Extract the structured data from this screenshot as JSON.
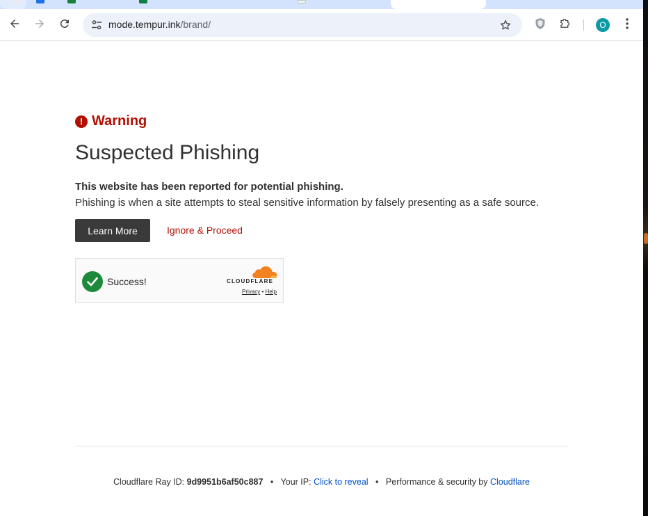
{
  "browser": {
    "url_host": "mode.tempur.ink",
    "url_path": "/brand/",
    "profile_initial": "O",
    "icons": {
      "back": "arrow-left-icon",
      "forward": "arrow-right-icon",
      "reload": "reload-icon",
      "site_info": "tune-icon",
      "bookmark": "star-icon",
      "shield": "shield-extension-icon",
      "extensions": "puzzle-icon",
      "menu": "kebab-menu-icon"
    }
  },
  "page": {
    "warning_label": "Warning",
    "title": "Suspected Phishing",
    "lead": "This website has been reported for potential phishing.",
    "description": "Phishing is when a site attempts to steal sensitive information by falsely presenting as a safe source.",
    "learn_more_label": "Learn More",
    "proceed_label": "Ignore & Proceed"
  },
  "turnstile": {
    "status": "Success!",
    "brand": "CLOUDFLARE",
    "privacy_label": "Privacy",
    "separator": "•",
    "help_label": "Help"
  },
  "footer": {
    "ray_label": "Cloudflare Ray ID:",
    "ray_id": "9d9951b6af50c887",
    "separator": "•",
    "ip_label": "Your IP:",
    "ip_link": "Click to reveal",
    "perf_label": "Performance & security by",
    "perf_link": "Cloudflare"
  },
  "colors": {
    "warning_red": "#b20f03",
    "link_blue": "#0051c3",
    "button_dark": "#3a3a3a",
    "success_green": "#1d8a3b",
    "cloudflare_orange": "#f48120",
    "avatar_teal": "#0b9aa6"
  }
}
